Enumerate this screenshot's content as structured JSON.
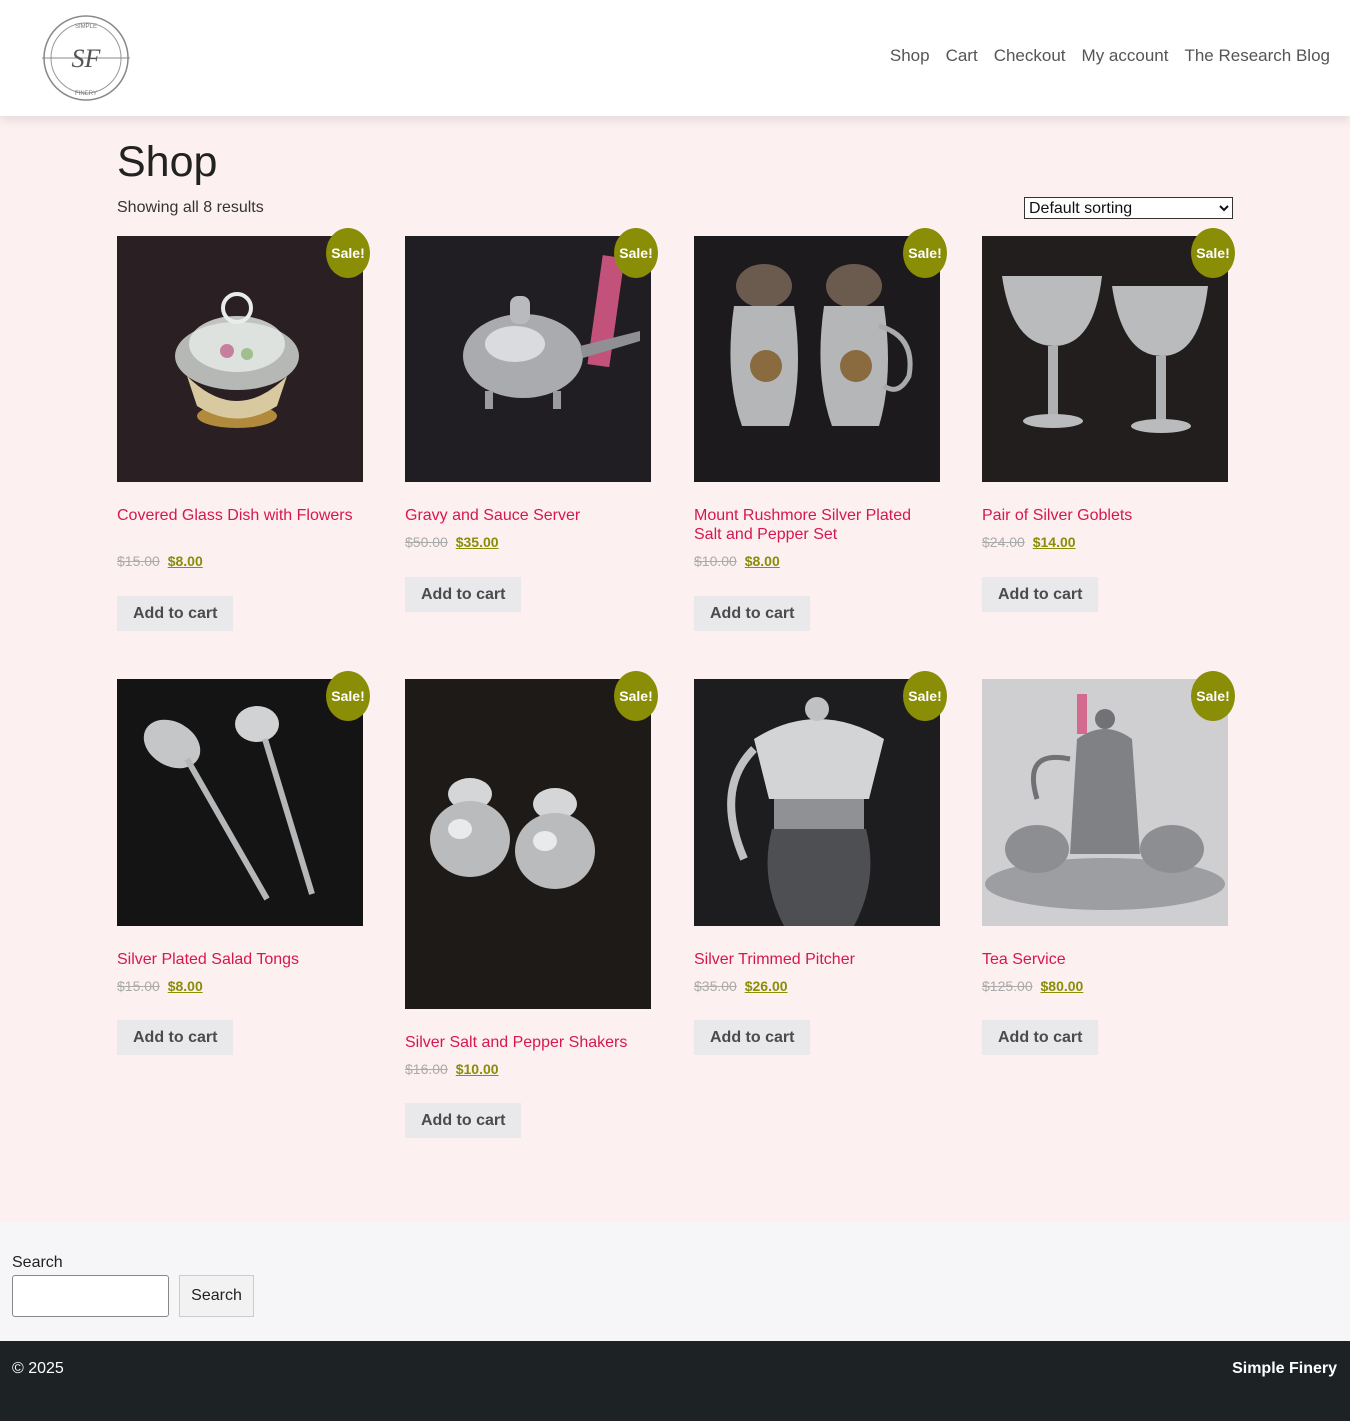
{
  "header": {
    "logo_text": {
      "top": "SIMPLE",
      "initials": "SF",
      "bottom": "FINERY"
    },
    "nav": [
      "Shop",
      "Cart",
      "Checkout",
      "My account",
      "The Research Blog"
    ]
  },
  "main": {
    "title": "Shop",
    "result_count": "Showing all 8 results",
    "sorting": {
      "selected": "Default sorting"
    },
    "sale_badge": "Sale!",
    "add_to_cart": "Add to cart",
    "products": [
      {
        "name": "Covered Glass Dish with Flowers",
        "old_price": "$15.00",
        "price": "$8.00",
        "image": "glass-dish-photo"
      },
      {
        "name": "Gravy and Sauce Server",
        "old_price": "$50.00",
        "price": "$35.00",
        "image": "gravy-server-photo"
      },
      {
        "name": "Mount Rushmore Silver Plated Salt and Pepper Set",
        "old_price": "$10.00",
        "price": "$8.00",
        "image": "salt-pepper-set-photo"
      },
      {
        "name": "Pair of Silver Goblets",
        "old_price": "$24.00",
        "price": "$14.00",
        "image": "goblets-photo"
      },
      {
        "name": "Silver Plated Salad Tongs",
        "old_price": "$15.00",
        "price": "$8.00",
        "image": "salad-tongs-photo"
      },
      {
        "name": "Silver Salt and Pepper Shakers",
        "old_price": "$16.00",
        "price": "$10.00",
        "image": "shakers-photo"
      },
      {
        "name": "Silver Trimmed Pitcher",
        "old_price": "$35.00",
        "price": "$26.00",
        "image": "pitcher-photo"
      },
      {
        "name": "Tea Service",
        "old_price": "$125.00",
        "price": "$80.00",
        "image": "tea-service-photo"
      }
    ]
  },
  "search": {
    "label": "Search",
    "button": "Search",
    "value": ""
  },
  "footer": {
    "copyright": "© 2025",
    "site_name": "Simple Finery"
  },
  "colors": {
    "accent": "#d6184d",
    "sale_badge": "#8a8d06",
    "background": "#fdf0f1",
    "footer": "#1d2225"
  }
}
